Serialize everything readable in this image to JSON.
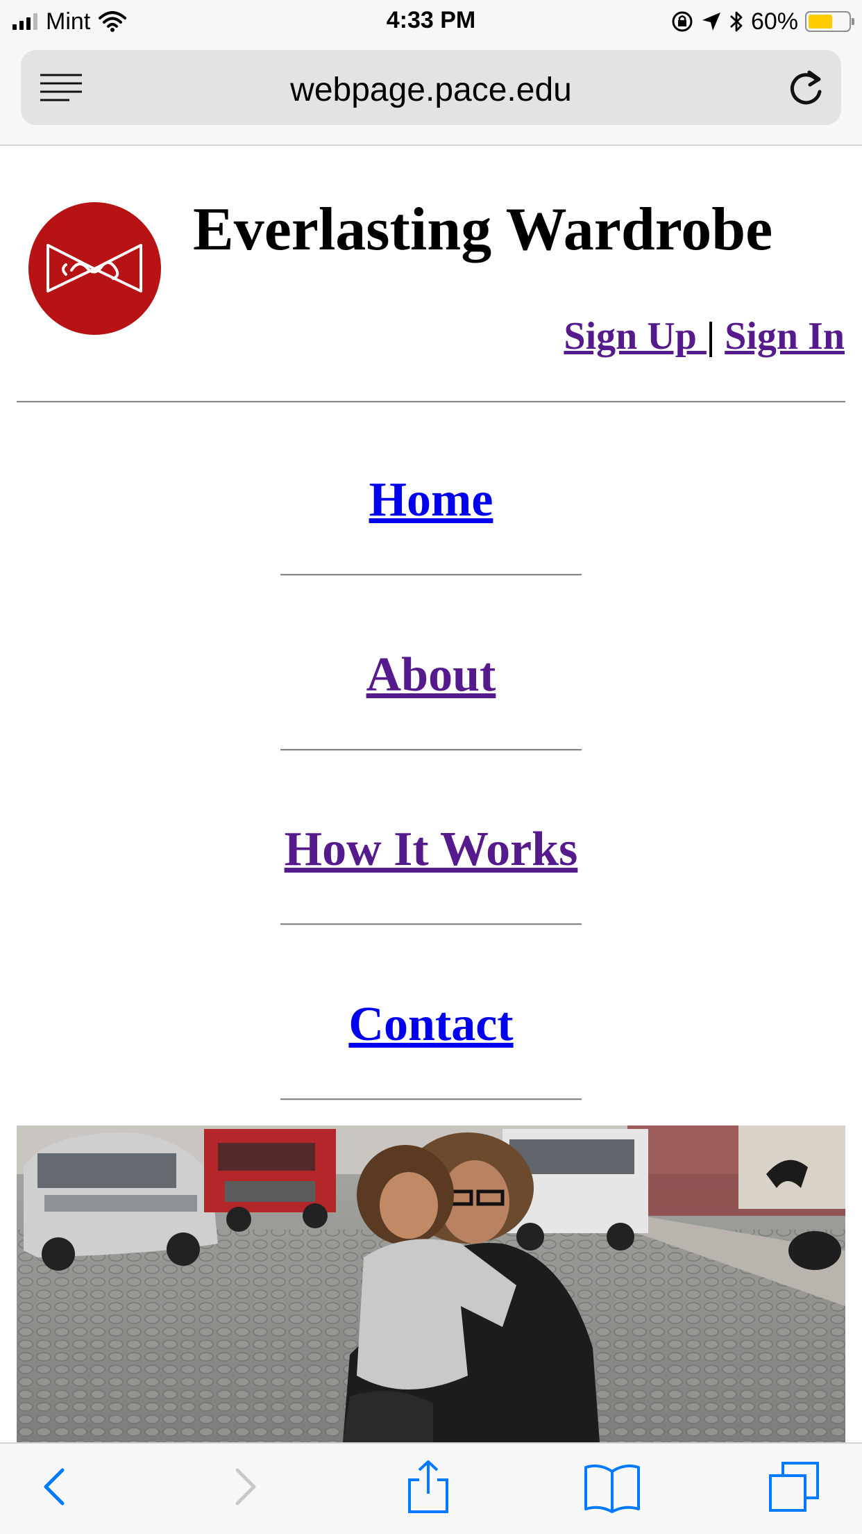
{
  "status_bar": {
    "carrier": "Mint",
    "time": "4:33 PM",
    "battery_percent": "60%",
    "battery_level": 0.6,
    "icons": [
      "signal-icon",
      "wifi-icon",
      "orientation-lock-icon",
      "location-icon",
      "bluetooth-icon",
      "battery-icon"
    ]
  },
  "browser": {
    "url": "webpage.pace.edu",
    "icons": [
      "reader-menu-icon",
      "reload-icon"
    ],
    "toolbar_icons": [
      "back-icon",
      "forward-icon",
      "share-icon",
      "bookmarks-icon",
      "tabs-icon"
    ]
  },
  "site": {
    "title": "Everlasting Wardrobe",
    "sign_up": "Sign Up ",
    "separator": "|",
    "sign_in": "Sign In"
  },
  "nav": {
    "home": "Home",
    "about": "About",
    "how_it_works": "How It Works",
    "contact": "Contact"
  },
  "colors": {
    "logo": "#b71315",
    "link": "#0000ee",
    "visited_link": "#551a8b",
    "ios_blue": "#007aff",
    "battery": "#ffcc00"
  }
}
